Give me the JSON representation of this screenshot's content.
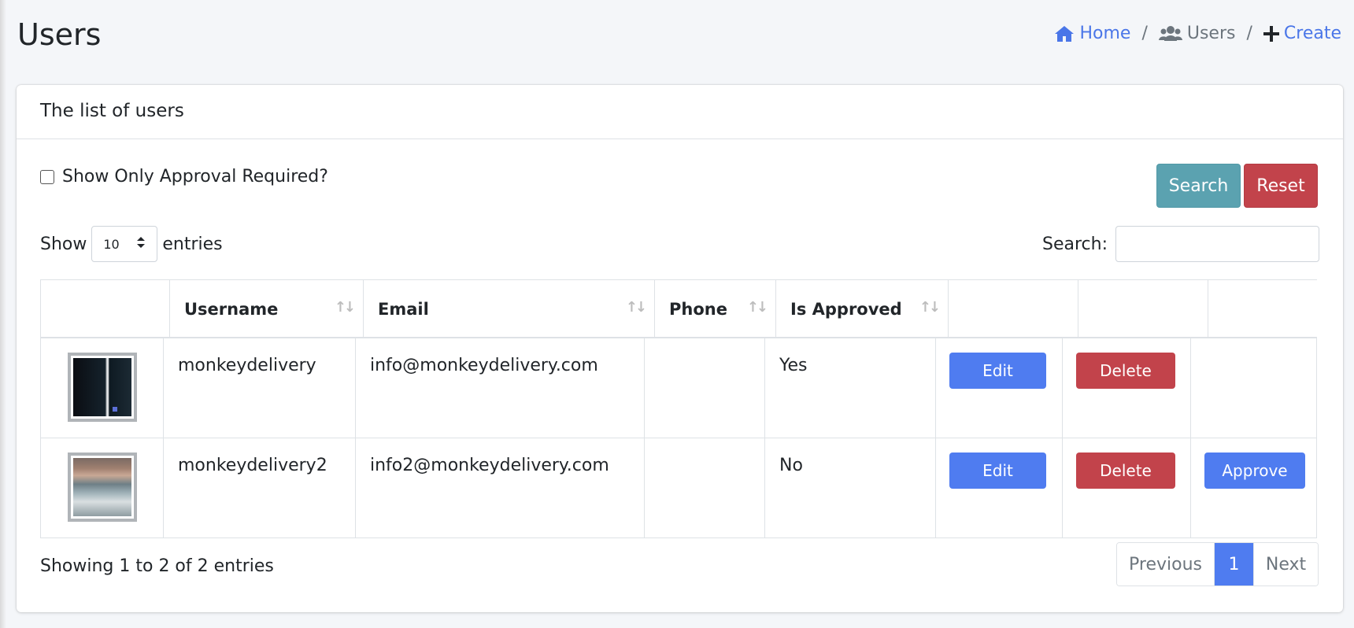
{
  "page": {
    "title": "Users"
  },
  "breadcrumb": {
    "home": "Home",
    "users": "Users",
    "create": "Create",
    "separator": "/"
  },
  "card": {
    "header": "The list of users"
  },
  "filters": {
    "approval_label": "Show Only Approval Required?",
    "approval_checked": false,
    "search_button": "Search",
    "reset_button": "Reset"
  },
  "table_controls": {
    "show_label": "Show",
    "entries_value": "10",
    "entries_label": "entries",
    "search_label": "Search:",
    "search_value": ""
  },
  "table": {
    "columns": [
      "",
      "Username",
      "Email",
      "Phone",
      "Is Approved",
      "",
      "",
      ""
    ],
    "rows": [
      {
        "avatar": "dark-building-thumbnail",
        "username": "monkeydelivery",
        "email": "info@monkeydelivery.com",
        "phone": "",
        "is_approved": "Yes",
        "edit": "Edit",
        "delete": "Delete",
        "approve": ""
      },
      {
        "avatar": "landscape-thumbnail",
        "username": "monkeydelivery2",
        "email": "info2@monkeydelivery.com",
        "phone": "",
        "is_approved": "No",
        "edit": "Edit",
        "delete": "Delete",
        "approve": "Approve"
      }
    ]
  },
  "footer": {
    "info": "Showing 1 to 2 of 2 entries",
    "previous": "Previous",
    "current_page": "1",
    "next": "Next"
  },
  "colors": {
    "primary": "#4f7cf0",
    "danger": "#c2434b",
    "info": "#5ba2b0",
    "background": "#f4f6f9"
  },
  "icons": {
    "home": "home-icon",
    "users": "users-icon",
    "create": "plus-icon",
    "sort": "sort-icon"
  }
}
